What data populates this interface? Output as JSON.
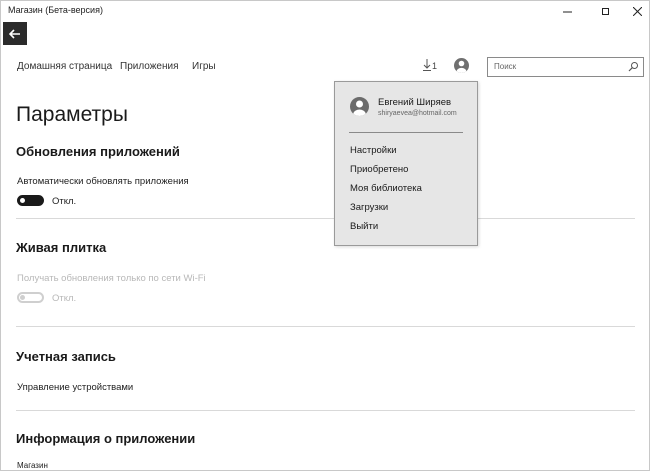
{
  "window": {
    "title": "Магазин (Бета-версия)"
  },
  "nav": {
    "home": "Домашняя страница",
    "apps": "Приложения",
    "games": "Игры"
  },
  "downloads": {
    "count": "1"
  },
  "search": {
    "placeholder": "Поиск"
  },
  "page": {
    "title": "Параметры",
    "updates": {
      "heading": "Обновления приложений",
      "auto_label": "Автоматически обновлять приложения",
      "auto_state": "Откл."
    },
    "live_tile": {
      "heading": "Живая плитка",
      "wifi_label": "Получать обновления только по сети Wi-Fi",
      "wifi_state": "Откл."
    },
    "account": {
      "heading": "Учетная запись",
      "manage_devices": "Управление устройствами"
    },
    "app_info": {
      "heading": "Информация о приложении",
      "app_name": "Магазин"
    }
  },
  "flyout": {
    "user_name": "Евгений Ширяев",
    "email": "shiryaevea@hotmail.com",
    "items": [
      "Настройки",
      "Приобретено",
      "Моя библиотека",
      "Загрузки",
      "Выйти"
    ]
  },
  "icons": {
    "back": "back-arrow-icon",
    "download": "download-icon",
    "avatar": "user-avatar-icon",
    "search": "search-icon"
  },
  "colors": {
    "back_button": "#2b2b2b",
    "flyout_bg": "#e6e6e6"
  }
}
